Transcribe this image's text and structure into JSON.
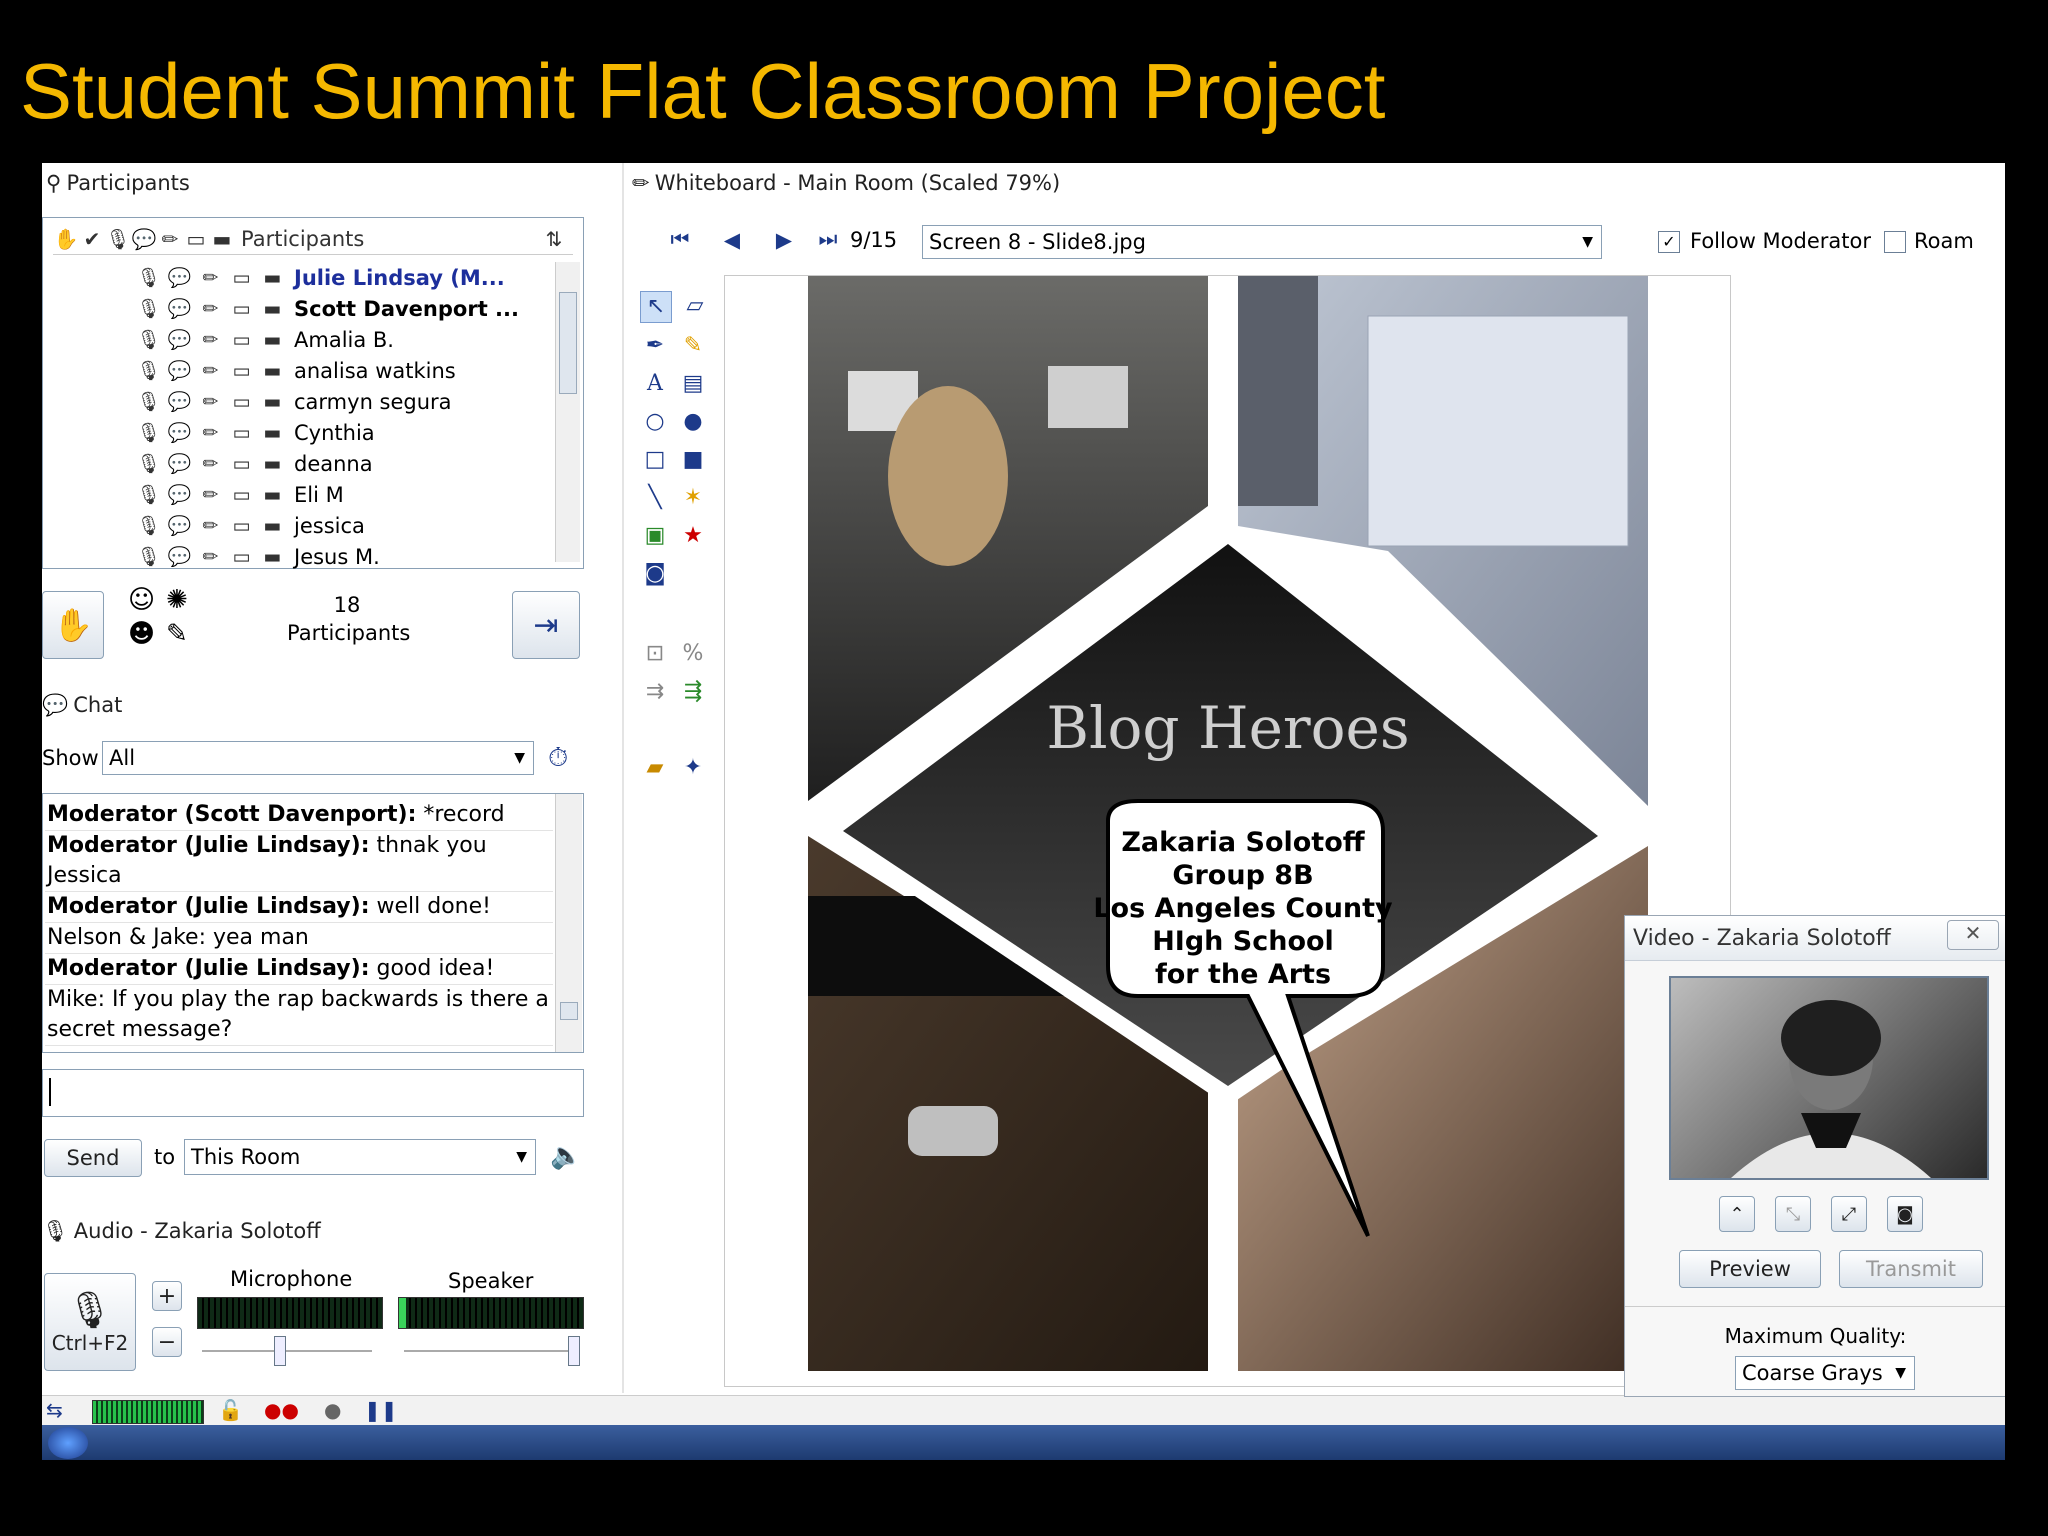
{
  "slide_title": "Student Summit Flat Classroom Project",
  "participants_panel": {
    "title": "Participants",
    "column_header": "Participants",
    "sort_icon": "sort-arrows-icon",
    "participants": [
      {
        "name": "Julie Lindsay (M...",
        "style": "bold-blue"
      },
      {
        "name": "Scott Davenport ...",
        "style": "bold"
      },
      {
        "name": "Amalia B.",
        "style": "normal"
      },
      {
        "name": "analisa watkins",
        "style": "normal"
      },
      {
        "name": "carmyn segura",
        "style": "normal"
      },
      {
        "name": "Cynthia",
        "style": "normal"
      },
      {
        "name": "deanna",
        "style": "normal"
      },
      {
        "name": "Eli M",
        "style": "normal"
      },
      {
        "name": "jessica",
        "style": "normal"
      },
      {
        "name": "Jesus M.",
        "style": "normal"
      }
    ],
    "count": "18",
    "count_label": "Participants"
  },
  "chat_panel": {
    "title": "Chat",
    "show_label": "Show",
    "show_value": "All",
    "messages": [
      {
        "sender": "Moderator (Scott Davenport):",
        "text": " *record",
        "bold": true
      },
      {
        "sender": "Moderator (Julie Lindsay):",
        "text": " thnak you Jessica",
        "bold": true
      },
      {
        "sender": "Moderator (Julie Lindsay):",
        "text": " well done!",
        "bold": true
      },
      {
        "sender": "Nelson & Jake:",
        "text": " yea man",
        "bold": false
      },
      {
        "sender": "Moderator (Julie Lindsay):",
        "text": " good idea!",
        "bold": true
      },
      {
        "sender": "Mike:",
        "text": " If you play the rap backwards is there a secret message?",
        "bold": false
      }
    ],
    "input_value": "",
    "send_label": "Send",
    "to_label": "to",
    "to_value": "This Room"
  },
  "audio_panel": {
    "title": "Audio - Zakaria Solotoff",
    "mic_shortcut": "Ctrl+F2",
    "microphone_label": "Microphone",
    "speaker_label": "Speaker",
    "plus": "+",
    "minus": "−",
    "microphone_level": 0.0,
    "speaker_level": 0.04
  },
  "whiteboard": {
    "title": "Whiteboard - Main Room (Scaled 79%)",
    "page_indicator": "9/15",
    "slide_select": "Screen 8 - Slide8.jpg",
    "follow_moderator_label": "Follow Moderator",
    "follow_moderator_checked": true,
    "roam_label": "Roam",
    "roam_checked": false,
    "check_mark": "✓",
    "slide": {
      "heading": "Blog Heroes",
      "bubble_lines": [
        "Zakaria Solotoff",
        "Group 8B",
        "Los Angeles County",
        "HIgh School",
        "for the Arts"
      ]
    }
  },
  "video_window": {
    "title": "Video - Zakaria Solotoff",
    "preview_label": "Preview",
    "transmit_label": "Transmit",
    "quality_label": "Maximum Quality:",
    "quality_value": "Coarse Grays"
  },
  "colors": {
    "title_accent": "#f5b800",
    "moderator_blue": "#1d2f9c",
    "panel_border": "#8aa0b5"
  }
}
